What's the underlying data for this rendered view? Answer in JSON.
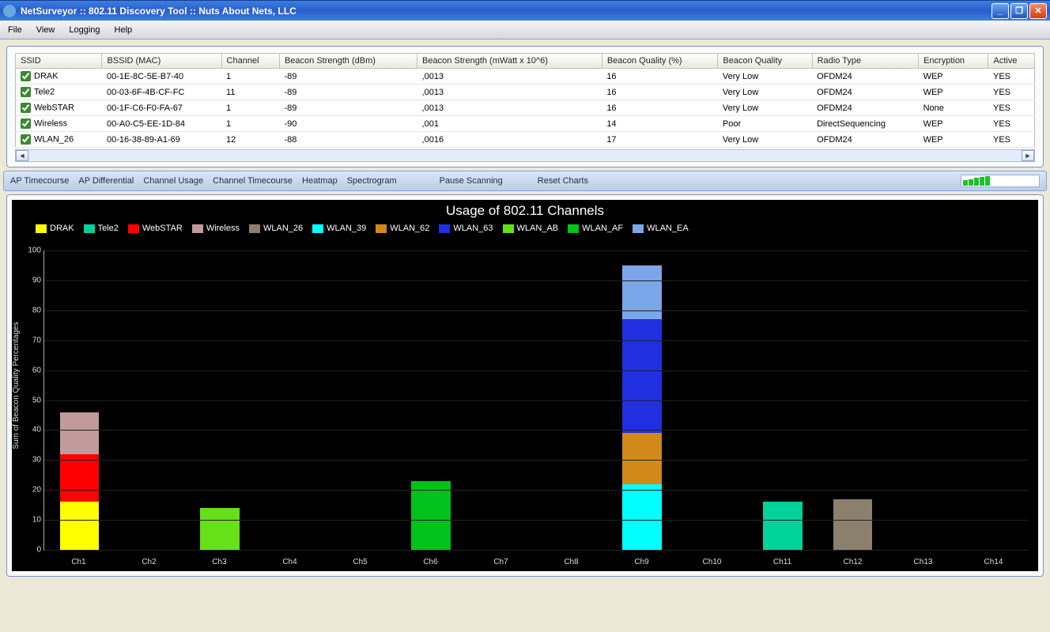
{
  "window": {
    "title": "NetSurveyor :: 802.11 Discovery Tool :: Nuts About Nets, LLC"
  },
  "menu": {
    "items": [
      "File",
      "View",
      "Logging",
      "Help"
    ]
  },
  "table": {
    "columns": [
      "SSID",
      "BSSID (MAC)",
      "Channel",
      "Beacon Strength (dBm)",
      "Beacon Strength (mWatt x 10^6)",
      "Beacon Quality (%)",
      "Beacon Quality",
      "Radio Type",
      "Encryption",
      "Active"
    ],
    "rows": [
      {
        "checked": true,
        "ssid": "DRAK",
        "bssid": "00-1E-8C-5E-B7-40",
        "ch": "1",
        "dbm": "-89",
        "mw": ",0013",
        "qpct": "16",
        "q": "Very Low",
        "radio": "OFDM24",
        "enc": "WEP",
        "active": "YES"
      },
      {
        "checked": true,
        "ssid": "Tele2",
        "bssid": "00-03-6F-4B-CF-FC",
        "ch": "11",
        "dbm": "-89",
        "mw": ",0013",
        "qpct": "16",
        "q": "Very Low",
        "radio": "OFDM24",
        "enc": "WEP",
        "active": "YES"
      },
      {
        "checked": true,
        "ssid": "WebSTAR",
        "bssid": "00-1F-C6-F0-FA-67",
        "ch": "1",
        "dbm": "-89",
        "mw": ",0013",
        "qpct": "16",
        "q": "Very Low",
        "radio": "OFDM24",
        "enc": "None",
        "active": "YES"
      },
      {
        "checked": true,
        "ssid": "Wireless",
        "bssid": "00-A0-C5-EE-1D-84",
        "ch": "1",
        "dbm": "-90",
        "mw": ",001",
        "qpct": "14",
        "q": "Poor",
        "radio": "DirectSequencing",
        "enc": "WEP",
        "active": "YES"
      },
      {
        "checked": true,
        "ssid": "WLAN_26",
        "bssid": "00-16-38-89-A1-69",
        "ch": "12",
        "dbm": "-88",
        "mw": ",0016",
        "qpct": "17",
        "q": "Very Low",
        "radio": "OFDM24",
        "enc": "WEP",
        "active": "YES"
      }
    ]
  },
  "toolbar": {
    "buttons": [
      "AP Timecourse",
      "AP Differential",
      "Channel Usage",
      "Channel Timecourse",
      "Heatmap",
      "Spectrogram"
    ],
    "actions": [
      "Pause Scanning",
      "Reset Charts"
    ]
  },
  "chart_data": {
    "type": "bar",
    "title": "Usage of 802.11 Channels",
    "ylabel": "Sum of Beacon Quality Percentages",
    "xlabel": "",
    "ylim": [
      0,
      100
    ],
    "yticks": [
      0,
      10,
      20,
      30,
      40,
      50,
      60,
      70,
      80,
      90,
      100
    ],
    "categories": [
      "Ch1",
      "Ch2",
      "Ch3",
      "Ch4",
      "Ch5",
      "Ch6",
      "Ch7",
      "Ch8",
      "Ch9",
      "Ch10",
      "Ch11",
      "Ch12",
      "Ch13",
      "Ch14"
    ],
    "series": [
      {
        "name": "DRAK",
        "color": "#ffff00",
        "values": [
          16,
          0,
          0,
          0,
          0,
          0,
          0,
          0,
          0,
          0,
          0,
          0,
          0,
          0
        ]
      },
      {
        "name": "Tele2",
        "color": "#00d29a",
        "values": [
          0,
          0,
          0,
          0,
          0,
          0,
          0,
          0,
          0,
          0,
          16,
          0,
          0,
          0
        ]
      },
      {
        "name": "WebSTAR",
        "color": "#ff0000",
        "values": [
          16,
          0,
          0,
          0,
          0,
          0,
          0,
          0,
          0,
          0,
          0,
          0,
          0,
          0
        ]
      },
      {
        "name": "Wireless",
        "color": "#c19a9a",
        "values": [
          14,
          0,
          0,
          0,
          0,
          0,
          0,
          0,
          0,
          0,
          0,
          0,
          0,
          0
        ]
      },
      {
        "name": "WLAN_26",
        "color": "#8a806d",
        "values": [
          0,
          0,
          0,
          0,
          0,
          0,
          0,
          0,
          0,
          0,
          0,
          17,
          0,
          0
        ]
      },
      {
        "name": "WLAN_39",
        "color": "#00ffff",
        "values": [
          0,
          0,
          0,
          0,
          0,
          0,
          0,
          0,
          22,
          0,
          0,
          0,
          0,
          0
        ]
      },
      {
        "name": "WLAN_62",
        "color": "#d18a1a",
        "values": [
          0,
          0,
          0,
          0,
          0,
          0,
          0,
          0,
          17,
          0,
          0,
          0,
          0,
          0
        ]
      },
      {
        "name": "WLAN_63",
        "color": "#2030e0",
        "values": [
          0,
          0,
          0,
          0,
          0,
          0,
          0,
          0,
          38,
          0,
          0,
          0,
          0,
          0
        ]
      },
      {
        "name": "WLAN_AB",
        "color": "#66e018",
        "values": [
          0,
          0,
          14,
          0,
          0,
          0,
          0,
          0,
          0,
          0,
          0,
          0,
          0,
          0
        ]
      },
      {
        "name": "WLAN_AF",
        "color": "#00c21a",
        "values": [
          0,
          0,
          0,
          0,
          0,
          23,
          0,
          0,
          0,
          0,
          0,
          0,
          0,
          0
        ]
      },
      {
        "name": "WLAN_EA",
        "color": "#7ba6e8",
        "values": [
          0,
          0,
          0,
          0,
          0,
          0,
          0,
          0,
          18,
          0,
          0,
          0,
          0,
          0
        ]
      }
    ]
  }
}
